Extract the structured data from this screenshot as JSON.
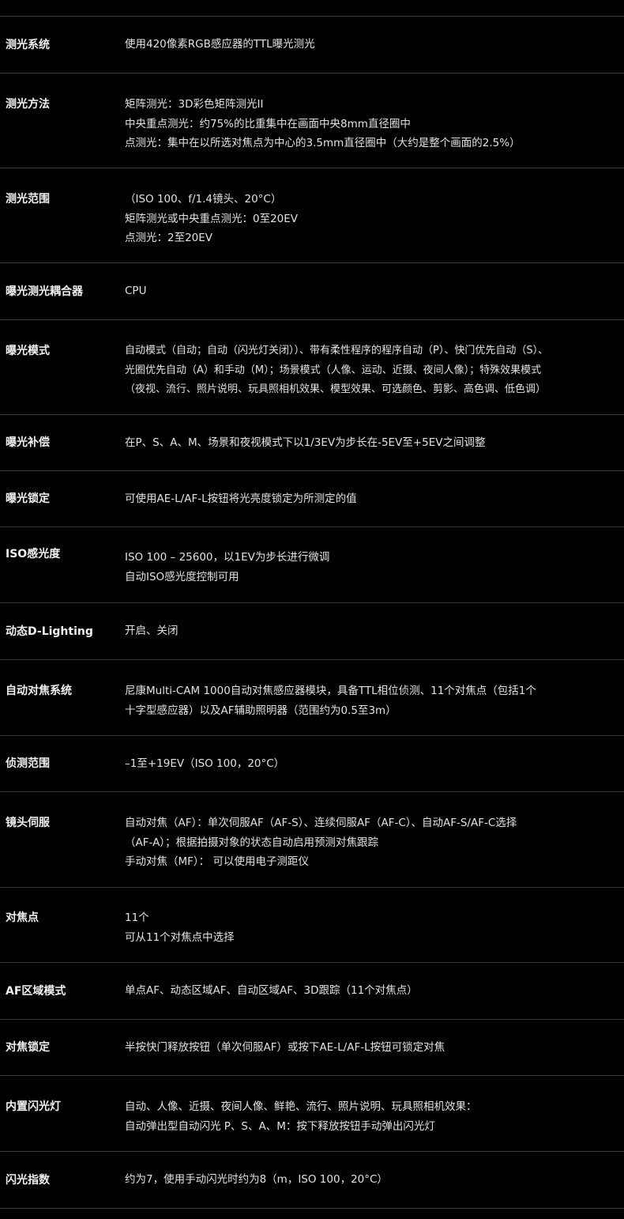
{
  "specs": [
    {
      "label": "测光系统",
      "lines": [
        "使用420像素RGB感应器的TTL曝光测光"
      ]
    },
    {
      "label": "测光方法",
      "lines": [
        "矩阵测光：3D彩色矩阵测光II",
        "中央重点测光：约75%的比重集中在画面中央8mm直径圈中",
        "点测光：集中在以所选对焦点为中心的3.5mm直径圈中（大约是整个画面的2.5%）"
      ]
    },
    {
      "label": "测光范围",
      "lines": [
        "（ISO 100、f/1.4镜头、20°C）",
        "矩阵测光或中央重点测光：0至20EV",
        "点测光：2至20EV"
      ]
    },
    {
      "label": "曝光测光耦合器",
      "lines": [
        "CPU"
      ]
    },
    {
      "label": "曝光模式",
      "lines": [
        "自动模式（自动；自动（闪光灯关闭））、带有柔性程序的程序自动（P）、快门优先自动（S）、",
        "光圈优先自动（A）和手动（M）；场景模式（人像、运动、近摄、夜间人像）；特殊效果模式",
        "（夜视、流行、照片说明、玩具照相机效果、模型效果、可选颜色、剪影、高色调、低色调）"
      ]
    },
    {
      "label": "曝光补偿",
      "lines": [
        "在P、S、A、M、场景和夜视模式下以1/3EV为步长在-5EV至+5EV之间调整"
      ]
    },
    {
      "label": "曝光锁定",
      "lines": [
        "可使用AE-L/AF-L按钮将光亮度锁定为所测定的值"
      ]
    },
    {
      "label": "ISO感光度",
      "lines": [
        "ISO 100 – 25600，以1EV为步长进行微调",
        "自动ISO感光度控制可用"
      ]
    },
    {
      "label": "动态D-Lighting",
      "lines": [
        "开启、关闭"
      ]
    },
    {
      "label": "自动对焦系统",
      "lines": [
        "尼康Multi-CAM 1000自动对焦感应器模块，具备TTL相位侦测、11个对焦点（包括1个",
        "十字型感应器）以及AF辅助照明器（范围约为0.5至3m）"
      ]
    },
    {
      "label": "侦测范围",
      "lines": [
        "–1至+19EV（ISO 100，20°C）"
      ]
    },
    {
      "label": "镜头伺服",
      "lines": [
        "自动对焦（AF）：单次伺服AF（AF-S）、连续伺服AF（AF-C）、自动AF-S/AF-C选择",
        "（AF-A）；根据拍摄对象的状态自动启用预测对焦跟踪",
        "手动对焦（MF）： 可以使用电子测距仪"
      ]
    },
    {
      "label": "对焦点",
      "lines": [
        "11个",
        "可从11个对焦点中选择"
      ]
    },
    {
      "label": "AF区域模式",
      "lines": [
        "单点AF、动态区域AF、自动区域AF、3D跟踪（11个对焦点）"
      ]
    },
    {
      "label": "对焦锁定",
      "lines": [
        "半按快门释放按钮（单次伺服AF）或按下AE-L/AF-L按钮可锁定对焦"
      ]
    },
    {
      "label": "内置闪光灯",
      "lines": [
        "自动、人像、近摄、夜间人像、鲜艳、流行、照片说明、玩具照相机效果：",
        "自动弹出型自动闪光 P、S、A、M：按下释放按钮手动弹出闪光灯"
      ]
    },
    {
      "label": "闪光指数",
      "lines": [
        "约为7，使用手动闪光时约为8（m，ISO 100，20°C）"
      ]
    }
  ]
}
